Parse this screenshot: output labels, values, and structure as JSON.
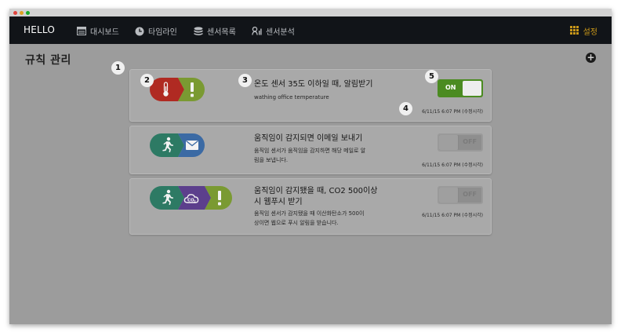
{
  "app": {
    "brand": "HELLO",
    "nav": [
      {
        "label": "대시보드",
        "icon": "dashboard-icon"
      },
      {
        "label": "타임라인",
        "icon": "clock-icon"
      },
      {
        "label": "센서목록",
        "icon": "database-icon"
      },
      {
        "label": "센서분석",
        "icon": "analysis-icon"
      }
    ],
    "settings_label": "설정",
    "settings_icon": "grid-icon",
    "accent_color": "#c99719"
  },
  "page": {
    "title": "규칙 관리",
    "add_icon": "plus-circle-icon"
  },
  "rules": [
    {
      "title": "온도 센서 35도 이하일 때, 알림받기",
      "title_lines": [
        "온도 센서 35도 이하일 때, 알림받기"
      ],
      "description_lines": [
        "wathing office temperature"
      ],
      "toggle": "ON",
      "enabled": true,
      "timestamp": "6/11/15 6:07 PM (수정시각)",
      "icons": [
        "thermometer-icon",
        "alert-icon"
      ]
    },
    {
      "title": "움직임이 감지되면 이메일 보내기",
      "title_lines": [
        "움직임이 감지되면 이메일 보내기"
      ],
      "description_lines": [
        "움직임 센서가 움직임을 감지하면 해당 메일로 알",
        "림을 보냅니다."
      ],
      "toggle": "OFF",
      "enabled": false,
      "timestamp": "6/11/15 6:07 PM (수정시각)",
      "icons": [
        "running-person-icon",
        "envelope-icon"
      ]
    },
    {
      "title": "움직임이 감지됐을 때, CO2 500이상 시 웹푸시 받기",
      "title_lines": [
        "움직임이 감지됐을 때, CO2 500이상",
        "시 웹푸시 받기"
      ],
      "description_lines": [
        "움직임 센서가 감지됐을 때 이산화탄소가 500이",
        "상이면 웹으로 푸시 알림을 받습니다."
      ],
      "toggle": "OFF",
      "enabled": false,
      "timestamp": "6/11/15 6:07 PM (수정시각)",
      "icons": [
        "running-person-icon",
        "co2-cloud-icon",
        "alert-icon"
      ]
    }
  ],
  "callouts": [
    "1",
    "2",
    "3",
    "4",
    "5"
  ],
  "colors": {
    "red": "#b02a22",
    "green": "#7a9a32",
    "teal": "#2d7a64",
    "blue": "#3b6aa4",
    "purple": "#5c3f8c",
    "toggle_on": "#4b8b21"
  }
}
